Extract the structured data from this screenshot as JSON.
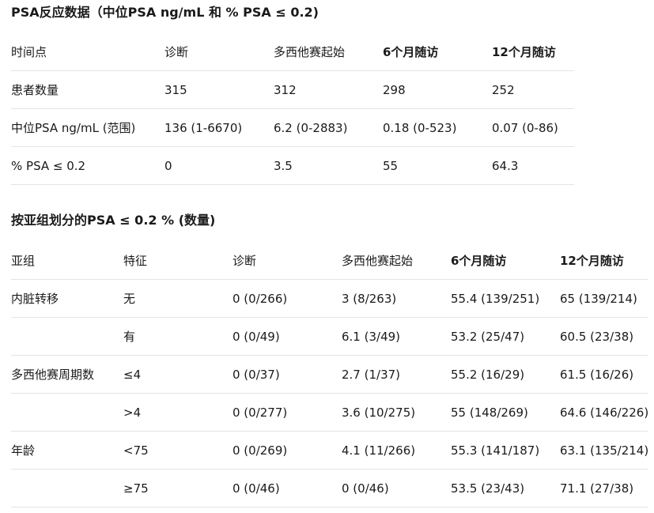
{
  "table1": {
    "title": "PSA反应数据（中位PSA ng/mL 和 % PSA ≤ 0.2)",
    "headers": [
      "时间点",
      "诊断",
      "多西他赛起始",
      "6个月随访",
      "12个月随访"
    ],
    "rows": [
      [
        "患者数量",
        "315",
        "312",
        "298",
        "252"
      ],
      [
        "中位PSA ng/mL (范围)",
        "136 (1-6670)",
        "6.2 (0-2883)",
        "0.18 (0-523)",
        "0.07 (0-86)"
      ],
      [
        "% PSA ≤ 0.2",
        "0",
        "3.5",
        "55",
        "64.3"
      ]
    ]
  },
  "table2": {
    "title": "按亚组划分的PSA ≤ 0.2 % (数量)",
    "headers": [
      "亚组",
      "特征",
      "诊断",
      "多西他赛起始",
      "6个月随访",
      "12个月随访"
    ],
    "rows": [
      [
        "内脏转移",
        "无",
        "0 (0/266)",
        "3 (8/263)",
        "55.4 (139/251)",
        "65 (139/214)"
      ],
      [
        "",
        "有",
        "0 (0/49)",
        "6.1 (3/49)",
        "53.2 (25/47)",
        "60.5 (23/38)"
      ],
      [
        "多西他赛周期数",
        "≤4",
        "0 (0/37)",
        "2.7 (1/37)",
        "55.2 (16/29)",
        "61.5 (16/26)"
      ],
      [
        "",
        ">4",
        "0 (0/277)",
        "3.6 (10/275)",
        "55 (148/269)",
        "64.6 (146/226)"
      ],
      [
        "年龄",
        "<75",
        "0 (0/269)",
        "4.1 (11/266)",
        "55.3 (141/187)",
        "63.1 (135/214)"
      ],
      [
        "",
        "≥75",
        "0 (0/46)",
        "0 (0/46)",
        "53.5 (23/43)",
        "71.1 (27/38)"
      ]
    ]
  }
}
